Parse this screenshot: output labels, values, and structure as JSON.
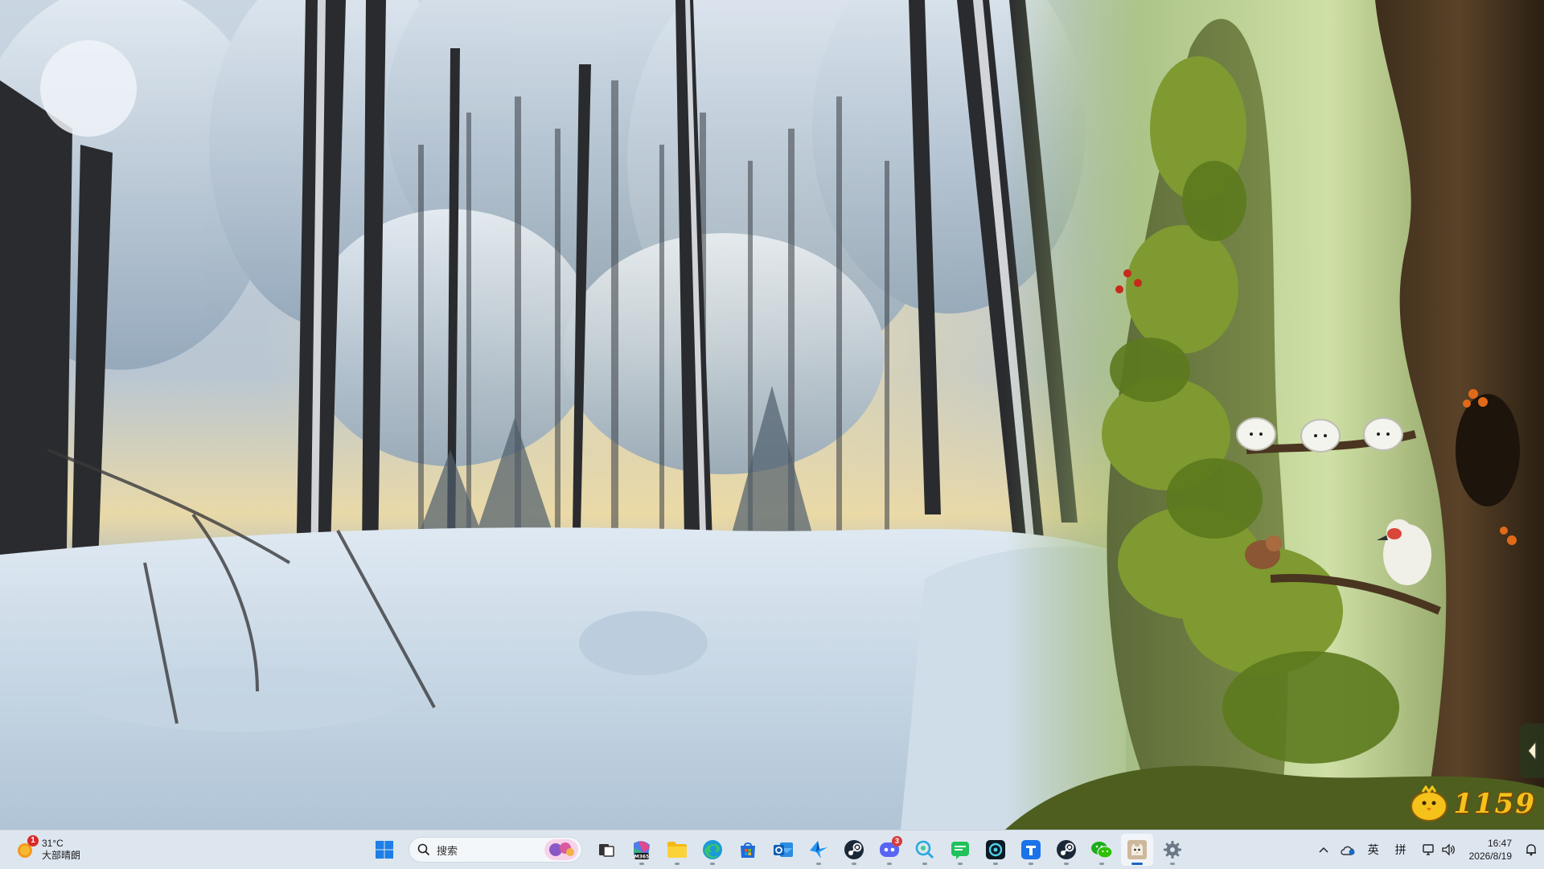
{
  "weather": {
    "badge": "1",
    "temperature": "31°C",
    "condition": "大部晴朗"
  },
  "search": {
    "placeholder": "搜索"
  },
  "taskbar": {
    "apps": [
      {
        "name": "start",
        "icon": "windows-logo-icon"
      },
      {
        "name": "task-view",
        "icon": "task-view-icon"
      },
      {
        "name": "microsoft-365",
        "icon": "microsoft-365-icon",
        "label": "M365"
      },
      {
        "name": "file-explorer",
        "icon": "folder-icon"
      },
      {
        "name": "edge",
        "icon": "edge-browser-icon"
      },
      {
        "name": "microsoft-store",
        "icon": "store-icon"
      },
      {
        "name": "outlook",
        "icon": "outlook-icon"
      },
      {
        "name": "app-bird",
        "icon": "bird-app-icon"
      },
      {
        "name": "steam",
        "icon": "steam-icon"
      },
      {
        "name": "discord",
        "icon": "discord-icon",
        "badge": "3"
      },
      {
        "name": "app-chat-search",
        "icon": "chat-search-icon"
      },
      {
        "name": "app-message",
        "icon": "message-icon"
      },
      {
        "name": "app-ring",
        "icon": "ring-app-icon"
      },
      {
        "name": "app-pin",
        "icon": "pin-app-icon"
      },
      {
        "name": "steam-2",
        "icon": "steam-icon"
      },
      {
        "name": "wechat",
        "icon": "wechat-icon"
      },
      {
        "name": "game-widget",
        "icon": "cat-game-icon"
      },
      {
        "name": "settings",
        "icon": "gear-icon"
      }
    ]
  },
  "tray": {
    "ime_lang": "英",
    "ime_mode": "拼",
    "time": "16:47",
    "date": "2026/8/19"
  },
  "game": {
    "score": "1159"
  },
  "colors": {
    "taskbar_bg": "#dde6ef",
    "accent": "#1a67c4",
    "score_gold": "#f4c21a",
    "badge_red": "#d62b2b"
  }
}
